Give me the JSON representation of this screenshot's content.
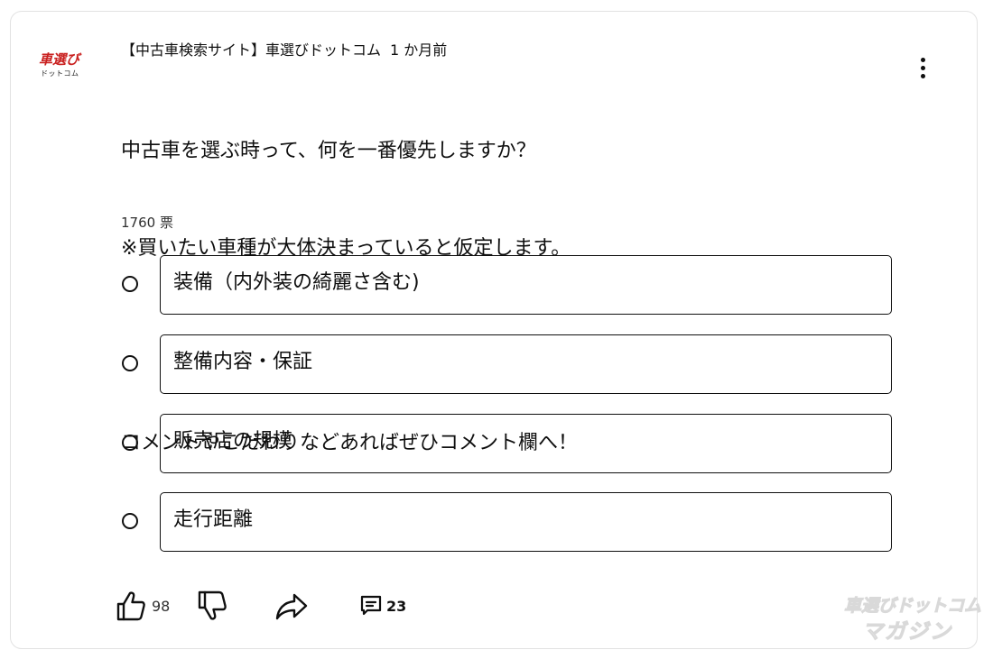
{
  "channel": {
    "avatar_main": "車選び",
    "avatar_sub": "ドットコム",
    "name": "【中古車検索サイト】車選びドットコム",
    "posted": "1 か月前"
  },
  "post": {
    "lines": [
      "中古車を選ぶ時って、何を一番優先しますか？",
      "※買いたい車種が大体決まっていると仮定します。",
      "",
      "コメントやこだわりなどあればぜひコメント欄へ！"
    ],
    "vote_count": "1760 票"
  },
  "poll": {
    "options": [
      {
        "label": "装備（内外装の綺麗さ含む)"
      },
      {
        "label": "整備内容・保証"
      },
      {
        "label": "販売店の規模"
      },
      {
        "label": "走行距離"
      }
    ]
  },
  "actions": {
    "like_count": "98",
    "comment_count": "23"
  },
  "watermark": {
    "line1": "車選びドットコム",
    "line2": "マガジン"
  },
  "icons": [
    "more-vert-icon",
    "thumbs-up-icon",
    "thumbs-down-icon",
    "share-icon",
    "comment-icon"
  ]
}
